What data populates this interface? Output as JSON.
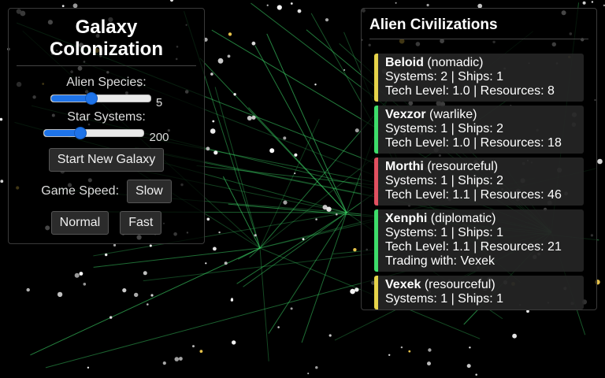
{
  "controls": {
    "title": "Galaxy Colonization",
    "alien_species_label": "Alien Species:",
    "alien_species_value": "5",
    "alien_species_fraction": 0.4,
    "star_systems_label": "Star Systems:",
    "star_systems_value": "200",
    "star_systems_fraction": 0.35,
    "start_button": "Start New Galaxy",
    "game_speed_label": "Game Speed:",
    "speed_slow": "Slow",
    "speed_normal": "Normal",
    "speed_fast": "Fast"
  },
  "civs": {
    "title": "Alien Civilizations",
    "items": [
      {
        "name": "Beloid",
        "trait": "(nomadic)",
        "line1": "Systems: 2 | Ships: 1",
        "line2": "Tech Level: 1.0 | Resources: 8",
        "line3": "",
        "color": "#e6d34a"
      },
      {
        "name": "Vexzor",
        "trait": "(warlike)",
        "line1": "Systems: 1 | Ships: 2",
        "line2": "Tech Level: 1.0 | Resources: 18",
        "line3": "",
        "color": "#3ddc6a"
      },
      {
        "name": "Morthi",
        "trait": "(resourceful)",
        "line1": "Systems: 1 | Ships: 2",
        "line2": "Tech Level: 1.1 | Resources: 46",
        "line3": "",
        "color": "#e05060"
      },
      {
        "name": "Xenphi",
        "trait": "(diplomatic)",
        "line1": "Systems: 1 | Ships: 1",
        "line2": "Tech Level: 1.1 | Resources: 21",
        "line3": "Trading with: Vexek",
        "color": "#3ddc6a"
      },
      {
        "name": "Vexek",
        "trait": "(resourceful)",
        "line1": "Systems: 1 | Ships: 1",
        "line2": "",
        "line3": "",
        "color": "#e6d34a"
      }
    ]
  }
}
